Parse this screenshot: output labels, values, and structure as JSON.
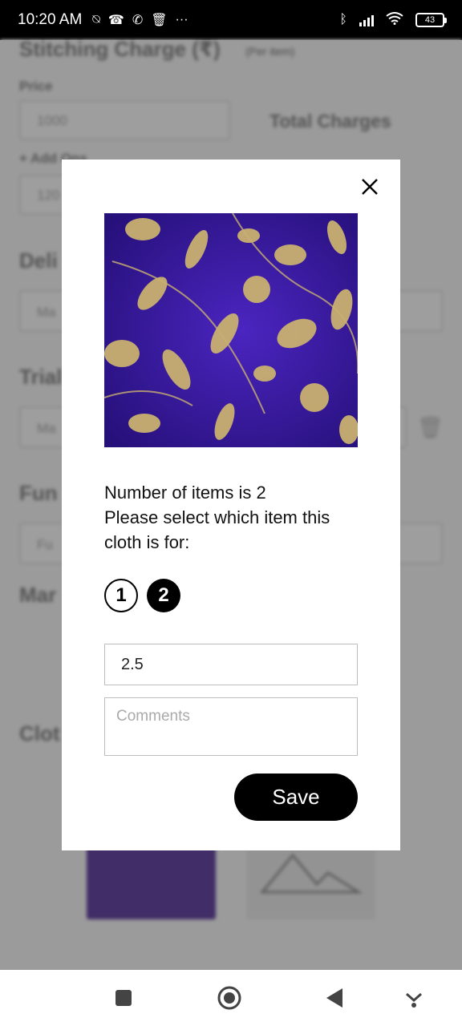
{
  "status_bar": {
    "time": "10:20 AM",
    "battery": "43"
  },
  "background": {
    "stitching_title": "Stitching Charge (₹)",
    "stitching_sub": "(Per item)",
    "price_label": "Price",
    "price_value": "1000",
    "total_label": "Total Charges",
    "add_on_label": "+ Add Ons",
    "add_on_value": "120",
    "delivery_label": "Deli",
    "delivery_value": "Ma",
    "trial_label": "Trial",
    "trial_value": "Ma",
    "function_label": "Fun",
    "function_value": "Fu",
    "mark_label": "Mar",
    "cloth_label": "Clot"
  },
  "modal": {
    "message_line1": "Number of items is 2",
    "message_line2": "Please select which item this cloth is for:",
    "item_options": [
      "1",
      "2"
    ],
    "selected_item": "2",
    "quantity_value": "2.5",
    "comments_placeholder": "Comments",
    "save_label": "Save"
  },
  "colors": {
    "accent": "#000000",
    "cloth": "#3a1a8f",
    "cloth_motif": "#c9b070"
  }
}
